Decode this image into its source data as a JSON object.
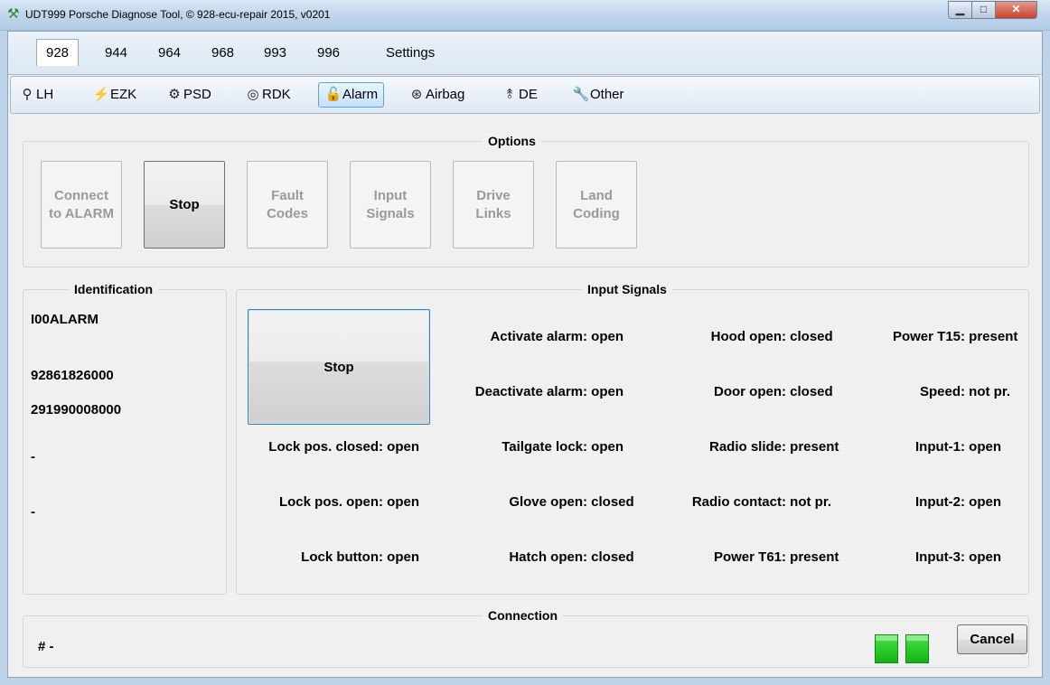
{
  "window": {
    "title": "UDT999 Porsche Diagnose Tool, © 928-ecu-repair 2015, v0201"
  },
  "tabs": [
    "928",
    "944",
    "964",
    "968",
    "993",
    "996",
    "Settings"
  ],
  "toolbar": [
    "LH",
    "EZK",
    "PSD",
    "RDK",
    "Alarm",
    "Airbag",
    "DE",
    "Other"
  ],
  "options": {
    "title": "Options",
    "buttons": [
      "Connect\nto ALARM",
      "Stop",
      "Fault\nCodes",
      "Input\nSignals",
      "Drive\nLinks",
      "Land\nCoding"
    ]
  },
  "identification": {
    "title": "Identification",
    "values": [
      "I00ALARM",
      "92861826000",
      "291990008000",
      "-",
      "-"
    ]
  },
  "input_signals": {
    "title": "Input Signals",
    "stop_label": "Stop",
    "signals": {
      "lock_pos_closed": {
        "label": "Lock pos. closed:",
        "value": "open"
      },
      "lock_pos_open": {
        "label": "Lock pos. open:",
        "value": "open"
      },
      "lock_button": {
        "label": "Lock button:",
        "value": "open"
      },
      "activate_alarm": {
        "label": "Activate alarm:",
        "value": "open"
      },
      "deactivate_alarm": {
        "label": "Deactivate alarm:",
        "value": "open"
      },
      "tailgate_lock": {
        "label": "Tailgate lock:",
        "value": "open"
      },
      "glove_open": {
        "label": "Glove open:",
        "value": "closed"
      },
      "hatch_open": {
        "label": "Hatch open:",
        "value": "closed"
      },
      "hood_open": {
        "label": "Hood open:",
        "value": "closed"
      },
      "door_open": {
        "label": "Door open:",
        "value": "closed"
      },
      "radio_slide": {
        "label": "Radio slide:",
        "value": "present"
      },
      "radio_contact": {
        "label": "Radio contact:",
        "value": "not pr."
      },
      "power_t61": {
        "label": "Power T61:",
        "value": "present"
      },
      "power_t15": {
        "label": "Power T15:",
        "value": "present"
      },
      "speed": {
        "label": "Speed:",
        "value": "not pr."
      },
      "input_1": {
        "label": "Input-1:",
        "value": "open"
      },
      "input_2": {
        "label": "Input-2:",
        "value": "open"
      },
      "input_3": {
        "label": "Input-3:",
        "value": "open"
      }
    }
  },
  "connection": {
    "title": "Connection",
    "status": "# -",
    "cancel_label": "Cancel",
    "led_color": "#22c322"
  }
}
